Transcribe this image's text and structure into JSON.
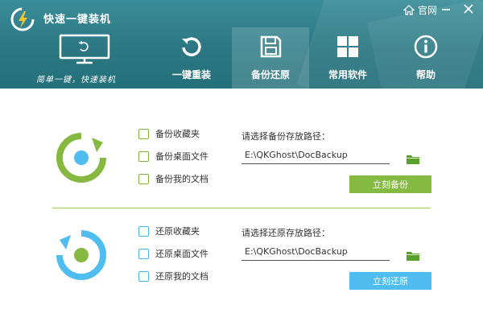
{
  "app": {
    "title": "快速一键装机",
    "slogan": "简单一键，快速装机"
  },
  "window_controls": {
    "official_site_label": "官网"
  },
  "nav": {
    "tabs": [
      {
        "label": "一键重装",
        "icon": "restart-icon"
      },
      {
        "label": "备份还原",
        "icon": "save-disk-icon",
        "active": true
      },
      {
        "label": "常用软件",
        "icon": "apps-grid-icon"
      },
      {
        "label": "帮助",
        "icon": "info-icon"
      }
    ]
  },
  "backup": {
    "options": [
      "备份收藏夹",
      "备份桌面文件",
      "备份我的文档"
    ],
    "path_label": "请选择备份存放路径：",
    "path_value": "E:\\QKGhost\\DocBackup",
    "button_label": "立刻备份"
  },
  "restore": {
    "options": [
      "还原收藏夹",
      "还原桌面文件",
      "还原我的文档"
    ],
    "path_label": "请选择还原存放路径：",
    "path_value": "E:\\QKGhost\\DocBackup",
    "button_label": "立刻还原"
  },
  "colors": {
    "header_teal": "#2b7782",
    "backup_green": "#85b941",
    "restore_blue": "#4fbdf0",
    "folder_green": "#5aa02c"
  }
}
